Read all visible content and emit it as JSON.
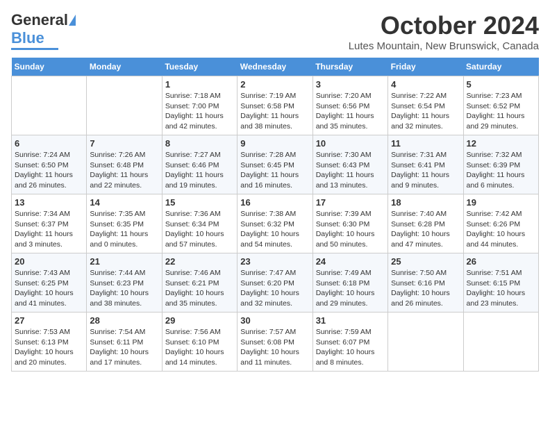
{
  "header": {
    "logo_general": "General",
    "logo_blue": "Blue",
    "month_title": "October 2024",
    "location": "Lutes Mountain, New Brunswick, Canada"
  },
  "days_of_week": [
    "Sunday",
    "Monday",
    "Tuesday",
    "Wednesday",
    "Thursday",
    "Friday",
    "Saturday"
  ],
  "weeks": [
    [
      {
        "day": "",
        "info": ""
      },
      {
        "day": "",
        "info": ""
      },
      {
        "day": "1",
        "info": "Sunrise: 7:18 AM\nSunset: 7:00 PM\nDaylight: 11 hours and 42 minutes."
      },
      {
        "day": "2",
        "info": "Sunrise: 7:19 AM\nSunset: 6:58 PM\nDaylight: 11 hours and 38 minutes."
      },
      {
        "day": "3",
        "info": "Sunrise: 7:20 AM\nSunset: 6:56 PM\nDaylight: 11 hours and 35 minutes."
      },
      {
        "day": "4",
        "info": "Sunrise: 7:22 AM\nSunset: 6:54 PM\nDaylight: 11 hours and 32 minutes."
      },
      {
        "day": "5",
        "info": "Sunrise: 7:23 AM\nSunset: 6:52 PM\nDaylight: 11 hours and 29 minutes."
      }
    ],
    [
      {
        "day": "6",
        "info": "Sunrise: 7:24 AM\nSunset: 6:50 PM\nDaylight: 11 hours and 26 minutes."
      },
      {
        "day": "7",
        "info": "Sunrise: 7:26 AM\nSunset: 6:48 PM\nDaylight: 11 hours and 22 minutes."
      },
      {
        "day": "8",
        "info": "Sunrise: 7:27 AM\nSunset: 6:46 PM\nDaylight: 11 hours and 19 minutes."
      },
      {
        "day": "9",
        "info": "Sunrise: 7:28 AM\nSunset: 6:45 PM\nDaylight: 11 hours and 16 minutes."
      },
      {
        "day": "10",
        "info": "Sunrise: 7:30 AM\nSunset: 6:43 PM\nDaylight: 11 hours and 13 minutes."
      },
      {
        "day": "11",
        "info": "Sunrise: 7:31 AM\nSunset: 6:41 PM\nDaylight: 11 hours and 9 minutes."
      },
      {
        "day": "12",
        "info": "Sunrise: 7:32 AM\nSunset: 6:39 PM\nDaylight: 11 hours and 6 minutes."
      }
    ],
    [
      {
        "day": "13",
        "info": "Sunrise: 7:34 AM\nSunset: 6:37 PM\nDaylight: 11 hours and 3 minutes."
      },
      {
        "day": "14",
        "info": "Sunrise: 7:35 AM\nSunset: 6:35 PM\nDaylight: 11 hours and 0 minutes."
      },
      {
        "day": "15",
        "info": "Sunrise: 7:36 AM\nSunset: 6:34 PM\nDaylight: 10 hours and 57 minutes."
      },
      {
        "day": "16",
        "info": "Sunrise: 7:38 AM\nSunset: 6:32 PM\nDaylight: 10 hours and 54 minutes."
      },
      {
        "day": "17",
        "info": "Sunrise: 7:39 AM\nSunset: 6:30 PM\nDaylight: 10 hours and 50 minutes."
      },
      {
        "day": "18",
        "info": "Sunrise: 7:40 AM\nSunset: 6:28 PM\nDaylight: 10 hours and 47 minutes."
      },
      {
        "day": "19",
        "info": "Sunrise: 7:42 AM\nSunset: 6:26 PM\nDaylight: 10 hours and 44 minutes."
      }
    ],
    [
      {
        "day": "20",
        "info": "Sunrise: 7:43 AM\nSunset: 6:25 PM\nDaylight: 10 hours and 41 minutes."
      },
      {
        "day": "21",
        "info": "Sunrise: 7:44 AM\nSunset: 6:23 PM\nDaylight: 10 hours and 38 minutes."
      },
      {
        "day": "22",
        "info": "Sunrise: 7:46 AM\nSunset: 6:21 PM\nDaylight: 10 hours and 35 minutes."
      },
      {
        "day": "23",
        "info": "Sunrise: 7:47 AM\nSunset: 6:20 PM\nDaylight: 10 hours and 32 minutes."
      },
      {
        "day": "24",
        "info": "Sunrise: 7:49 AM\nSunset: 6:18 PM\nDaylight: 10 hours and 29 minutes."
      },
      {
        "day": "25",
        "info": "Sunrise: 7:50 AM\nSunset: 6:16 PM\nDaylight: 10 hours and 26 minutes."
      },
      {
        "day": "26",
        "info": "Sunrise: 7:51 AM\nSunset: 6:15 PM\nDaylight: 10 hours and 23 minutes."
      }
    ],
    [
      {
        "day": "27",
        "info": "Sunrise: 7:53 AM\nSunset: 6:13 PM\nDaylight: 10 hours and 20 minutes."
      },
      {
        "day": "28",
        "info": "Sunrise: 7:54 AM\nSunset: 6:11 PM\nDaylight: 10 hours and 17 minutes."
      },
      {
        "day": "29",
        "info": "Sunrise: 7:56 AM\nSunset: 6:10 PM\nDaylight: 10 hours and 14 minutes."
      },
      {
        "day": "30",
        "info": "Sunrise: 7:57 AM\nSunset: 6:08 PM\nDaylight: 10 hours and 11 minutes."
      },
      {
        "day": "31",
        "info": "Sunrise: 7:59 AM\nSunset: 6:07 PM\nDaylight: 10 hours and 8 minutes."
      },
      {
        "day": "",
        "info": ""
      },
      {
        "day": "",
        "info": ""
      }
    ]
  ]
}
